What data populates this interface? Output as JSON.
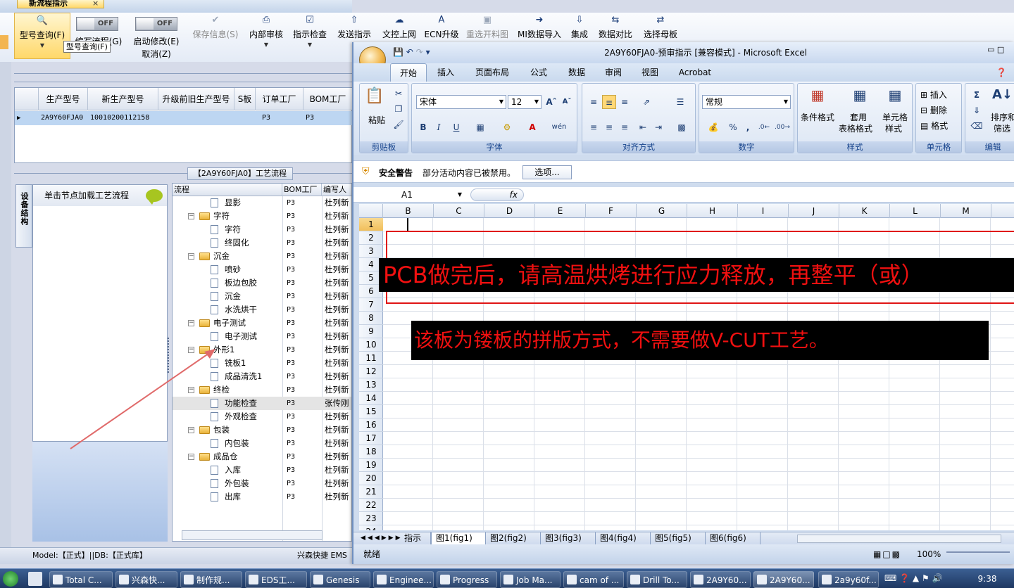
{
  "app": {
    "tab_title": "新流程指示",
    "tab_close": "×",
    "ribbon": [
      {
        "id": "model",
        "label": "型号查询(F)",
        "icon": "search-icon"
      },
      {
        "id": "edit_flow",
        "label": "编写流程(G)",
        "icon": "toggle-off-icon"
      },
      {
        "id": "start_edit",
        "label": "启动修改(E)",
        "label2": "取消(Z)",
        "icon": "toggle-off-icon"
      },
      {
        "id": "save",
        "label": "保存信息(S)",
        "icon": "check-icon",
        "disabled": true
      },
      {
        "id": "audit",
        "label": "内部审核",
        "icon": "printer-icon"
      },
      {
        "id": "check",
        "label": "指示检查",
        "icon": "checkbox-icon"
      },
      {
        "id": "send",
        "label": "发送指示",
        "icon": "upload-icon"
      },
      {
        "id": "upload",
        "label": "文控上网",
        "icon": "cloud-upload-icon"
      },
      {
        "id": "ecn",
        "label": "ECN升级",
        "icon": "letter-a-icon"
      },
      {
        "id": "reselect",
        "label": "重选开料图",
        "icon": "image-icon",
        "disabled": true
      },
      {
        "id": "mi_import",
        "label": "MI数据导入",
        "icon": "import-icon"
      },
      {
        "id": "integrate",
        "label": "集成",
        "icon": "download-icon"
      },
      {
        "id": "compare",
        "label": "数据对比",
        "icon": "compare-icon"
      },
      {
        "id": "template",
        "label": "选择母板",
        "icon": "shuffle-icon"
      }
    ],
    "toggle_text": "OFF",
    "tooltip": "型号查询(F)",
    "grid": {
      "headers": [
        "生产型号",
        "新生产型号",
        "升级前旧生产型号",
        "S板",
        "订单工厂",
        "BOM工厂"
      ],
      "row": [
        "2A9Y60FJA0",
        "10010200112158",
        "",
        "",
        "P3",
        "P3"
      ]
    },
    "flow_title": "【2A9Y60FJA0】工艺流程",
    "vertical_tab": "设备结构",
    "node_panel_title": "单击节点加载工艺流程",
    "tree": {
      "headers": [
        "流程",
        "BOM工厂",
        "编写人"
      ],
      "rows": [
        {
          "level": 2,
          "name": "显影",
          "bom": "P3",
          "who": "杜列新"
        },
        {
          "level": 1,
          "name": "字符",
          "bom": "P3",
          "who": "杜列新"
        },
        {
          "level": 2,
          "name": "字符",
          "bom": "P3",
          "who": "杜列新"
        },
        {
          "level": 2,
          "name": "终固化",
          "bom": "P3",
          "who": "杜列新"
        },
        {
          "level": 1,
          "name": "沉金",
          "bom": "P3",
          "who": "杜列新"
        },
        {
          "level": 2,
          "name": "喷砂",
          "bom": "P3",
          "who": "杜列新"
        },
        {
          "level": 2,
          "name": "板边包胶",
          "bom": "P3",
          "who": "杜列新"
        },
        {
          "level": 2,
          "name": "沉金",
          "bom": "P3",
          "who": "杜列新"
        },
        {
          "level": 2,
          "name": "水洗烘干",
          "bom": "P3",
          "who": "杜列新"
        },
        {
          "level": 1,
          "name": "电子测试",
          "bom": "P3",
          "who": "杜列新"
        },
        {
          "level": 2,
          "name": "电子测试",
          "bom": "P3",
          "who": "杜列新"
        },
        {
          "level": 1,
          "name": "外形1",
          "bom": "P3",
          "who": "杜列新"
        },
        {
          "level": 2,
          "name": "铣板1",
          "bom": "P3",
          "who": "杜列新"
        },
        {
          "level": 2,
          "name": "成品清洗1",
          "bom": "P3",
          "who": "杜列新"
        },
        {
          "level": 1,
          "name": "终检",
          "bom": "P3",
          "who": "杜列新"
        },
        {
          "level": 2,
          "name": "功能检查",
          "bom": "P3",
          "who": "张传刚",
          "selected": true
        },
        {
          "level": 2,
          "name": "外观检查",
          "bom": "P3",
          "who": "杜列新"
        },
        {
          "level": 1,
          "name": "包装",
          "bom": "P3",
          "who": "杜列新"
        },
        {
          "level": 2,
          "name": "内包装",
          "bom": "P3",
          "who": "杜列新"
        },
        {
          "level": 1,
          "name": "成品仓",
          "bom": "P3",
          "who": "杜列新"
        },
        {
          "level": 2,
          "name": "入库",
          "bom": "P3",
          "who": "杜列新"
        },
        {
          "level": 2,
          "name": "外包装",
          "bom": "P3",
          "who": "杜列新"
        },
        {
          "level": 2,
          "name": "出库",
          "bom": "P3",
          "who": "杜列新"
        }
      ]
    },
    "status": {
      "model": "Model:【正式】||DB:【正式库】",
      "company": "兴森快捷 EMS"
    }
  },
  "excel": {
    "caption": "2A9Y60FJA0-预审指示 [兼容模式] - Microsoft Excel",
    "tabs": [
      "开始",
      "插入",
      "页面布局",
      "公式",
      "数据",
      "审阅",
      "视图",
      "Acrobat"
    ],
    "groups": {
      "clipboard": "剪贴板",
      "font": "字体",
      "align": "对齐方式",
      "number": "数字",
      "styles": "样式",
      "cells": "单元格",
      "edit": "编辑"
    },
    "paste_label": "粘贴",
    "font_name": "宋体",
    "font_size": "12",
    "number_format": "常规",
    "style_buttons": {
      "cond": "条件格式",
      "table1": "套用",
      "table2": "表格格式",
      "cell1": "单元格",
      "cell2": "样式"
    },
    "cell_buttons": {
      "insert": "插入",
      "delete": "删除",
      "format": "格式"
    },
    "edit_buttons": {
      "sort1": "排序和",
      "sort2": "筛选"
    },
    "security": {
      "title": "安全警告",
      "text": "部分活动内容已被禁用。",
      "button": "选项..."
    },
    "namebox": "A1",
    "fx": "fx",
    "columns": [
      "B",
      "C",
      "D",
      "E",
      "F",
      "G",
      "H",
      "I",
      "J",
      "K",
      "L",
      "M",
      "N"
    ],
    "rows": [
      "1",
      "2",
      "3",
      "4",
      "5",
      "6",
      "7",
      "8",
      "9",
      "10",
      "11",
      "12",
      "13",
      "14",
      "15",
      "16",
      "17",
      "18",
      "19",
      "20",
      "21",
      "22",
      "23",
      "24"
    ],
    "note1": "PCB做完后，请高温烘烤进行应力释放，再整平（或）",
    "note2": "该板为镂板的拼版方式，不需要做V-CUT工艺。",
    "sheets": [
      "指示",
      "图1(fig1)",
      "图2(fig2)",
      "图3(fig3)",
      "图4(fig4)",
      "图5(fig5)",
      "图6(fig6)"
    ],
    "status_ready": "就绪",
    "zoom": "100%"
  },
  "taskbar": {
    "items": [
      "Total C...",
      "兴森快...",
      "制作规...",
      "EDS工...",
      "Genesis",
      "Enginee...",
      "Progress",
      "Job Ma...",
      "cam of ...",
      "Drill To...",
      "2A9Y60...",
      "2A9Y60...",
      "2a9y60f..."
    ],
    "clock": "9:38"
  }
}
